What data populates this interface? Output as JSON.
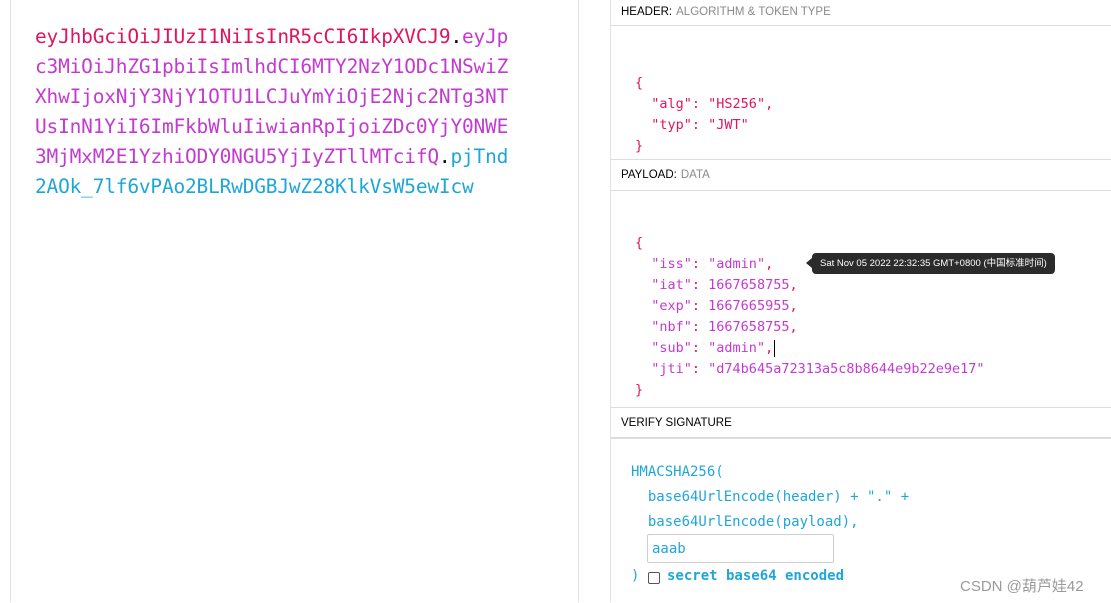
{
  "encoded": {
    "header": "eyJhbGciOiJIUzI1NiIsInR5cCI6IkpXVCJ9",
    "dot1": ".",
    "payload": "eyJpc3MiOiJhZG1pbiIsImlhdCI6MTY2NzY1ODc1NSwiZXhwIjoxNjY3NjY1OTU1LCJuYmYiOjE2Njc2NTg3NTUsInN1YiI6ImFkbWluIiwianRpIjoiZDc0YjY0NWE3MjMxM2E1YzhiODY0NGU5YjIyZTllMTcifQ",
    "dot2": ".",
    "signature": "pjTnd2AOk_7lf6vPAo2BLRwDGBJwZ28KlkVsW5ewIcw"
  },
  "header_section": {
    "title": "HEADER:",
    "subtitle": "ALGORITHM & TOKEN TYPE",
    "fields": {
      "alg_key": "\"alg\"",
      "alg_value": "\"HS256\"",
      "typ_key": "\"typ\"",
      "typ_value": "\"JWT\""
    }
  },
  "payload_section": {
    "title": "PAYLOAD:",
    "subtitle": "DATA",
    "fields": {
      "iss_key": "\"iss\"",
      "iss_value": "\"admin\"",
      "iat_key": "\"iat\"",
      "iat_value": "1667658755",
      "exp_key": "\"exp\"",
      "exp_value": "1667665955",
      "nbf_key": "\"nbf\"",
      "nbf_value": "1667658755",
      "sub_key": "\"sub\"",
      "sub_value": "\"admin\"",
      "jti_key": "\"jti\"",
      "jti_value": "\"d74b645a72313a5c8b8644e9b22e9e17\""
    },
    "tooltip": "Sat Nov 05 2022 22:32:35 GMT+0800 (中国标准时间)"
  },
  "verify_section": {
    "title": "VERIFY SIGNATURE",
    "line1": "HMACSHA256(",
    "line2": "  base64UrlEncode(header) + \".\" +",
    "line3": "  base64UrlEncode(payload),",
    "secret_value": "aaab",
    "close_paren": ")",
    "checkbox_label": "secret base64 encoded",
    "checkbox_checked": false
  },
  "watermark": "CSDN @葫芦娃42",
  "colors": {
    "header": "#e0145f",
    "payload": "#c33ad1",
    "signature": "#1fa6d8"
  }
}
